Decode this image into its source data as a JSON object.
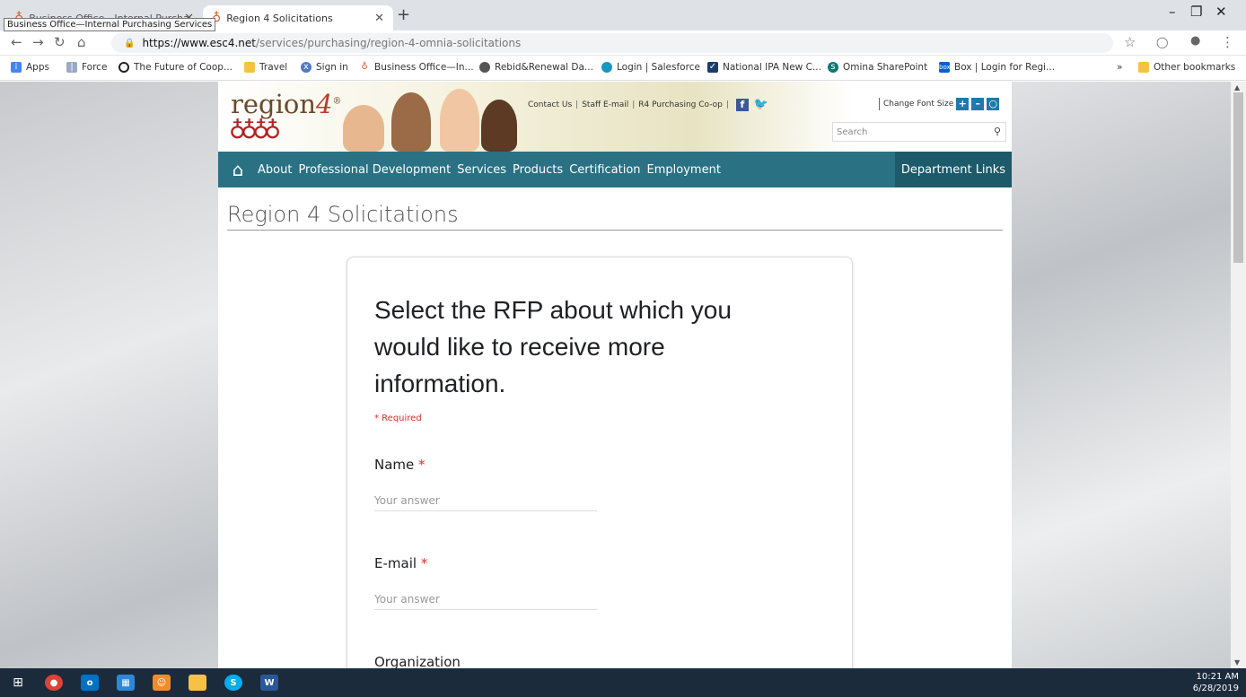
{
  "browser": {
    "tabs": [
      {
        "title": "Business Office—Internal Purcha",
        "active": false
      },
      {
        "title": "Region 4 Solicitations",
        "active": true
      }
    ],
    "tooltip": "Business Office—Internal Purchasing Services",
    "url_host": "https://www.esc4.net",
    "url_path": "/services/purchasing/region-4-omnia-solicitations",
    "bookmarks": [
      {
        "label": "Apps",
        "icon": "apps-grid-icon"
      },
      {
        "label": "Force",
        "icon": "force-icon"
      },
      {
        "label": "The Future of Coop...",
        "icon": "circle-icon"
      },
      {
        "label": "Travel",
        "icon": "folder-icon"
      },
      {
        "label": "Sign in",
        "icon": "x-circle-icon"
      },
      {
        "label": "Business Office—In...",
        "icon": "apple-icon"
      },
      {
        "label": "Rebid&Renewal Da...",
        "icon": "globe-icon"
      },
      {
        "label": "Login | Salesforce",
        "icon": "salesforce-icon"
      },
      {
        "label": "National IPA New C...",
        "icon": "check-icon"
      },
      {
        "label": "Omina SharePoint",
        "icon": "sharepoint-icon"
      },
      {
        "label": "Box | Login for Regi...",
        "icon": "box-icon"
      }
    ],
    "overflow": "»",
    "other_bookmarks": "Other bookmarks"
  },
  "site": {
    "logo": "region",
    "logo_num": "4",
    "top_links": [
      "Contact Us",
      "Staff E-mail",
      "R4 Purchasing Co-op"
    ],
    "font_size_label": "Change Font Size",
    "search_placeholder": "Search",
    "nav": [
      "About",
      "Professional Development",
      "Services",
      "Products",
      "Certification",
      "Employment"
    ],
    "dept_links": "Department Links",
    "page_title": "Region 4 Solicitations"
  },
  "form": {
    "title": "Select the RFP about which you would like to receive more information.",
    "required_note": "* Required",
    "questions": [
      {
        "label": "Name",
        "required": true,
        "placeholder": "Your answer"
      },
      {
        "label": "E-mail",
        "required": true,
        "placeholder": "Your answer"
      },
      {
        "label": "Organization",
        "required": false
      }
    ]
  },
  "taskbar": {
    "time": "10:21 AM",
    "date": "6/28/2019"
  },
  "colors": {
    "nav": "#2a7183",
    "required": "#d93025",
    "taskbar": "#1c2b3c"
  }
}
